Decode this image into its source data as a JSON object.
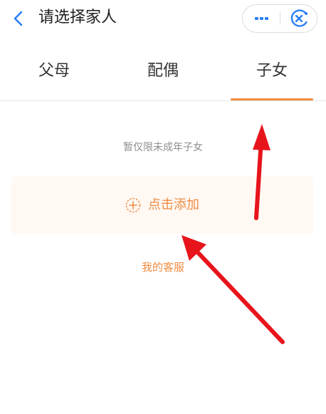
{
  "nav": {
    "title": "请选择家人",
    "back_icon": "back-arrow-icon",
    "more_icon": "more-dots-icon",
    "close_icon": "close-circle-icon"
  },
  "tabs": [
    {
      "label": "父母",
      "active": false
    },
    {
      "label": "配偶",
      "active": false
    },
    {
      "label": "子女",
      "active": true
    }
  ],
  "content": {
    "hint": "暂仅限未成年子女",
    "add_label": "点击添加",
    "add_icon": "plus-circle-icon",
    "service_link": "我的客服"
  },
  "colors": {
    "accent": "#f08c42",
    "nav_icon": "#2b7ef5",
    "card_bg": "#fff8f3",
    "annotation_arrow": "#e8141c"
  }
}
